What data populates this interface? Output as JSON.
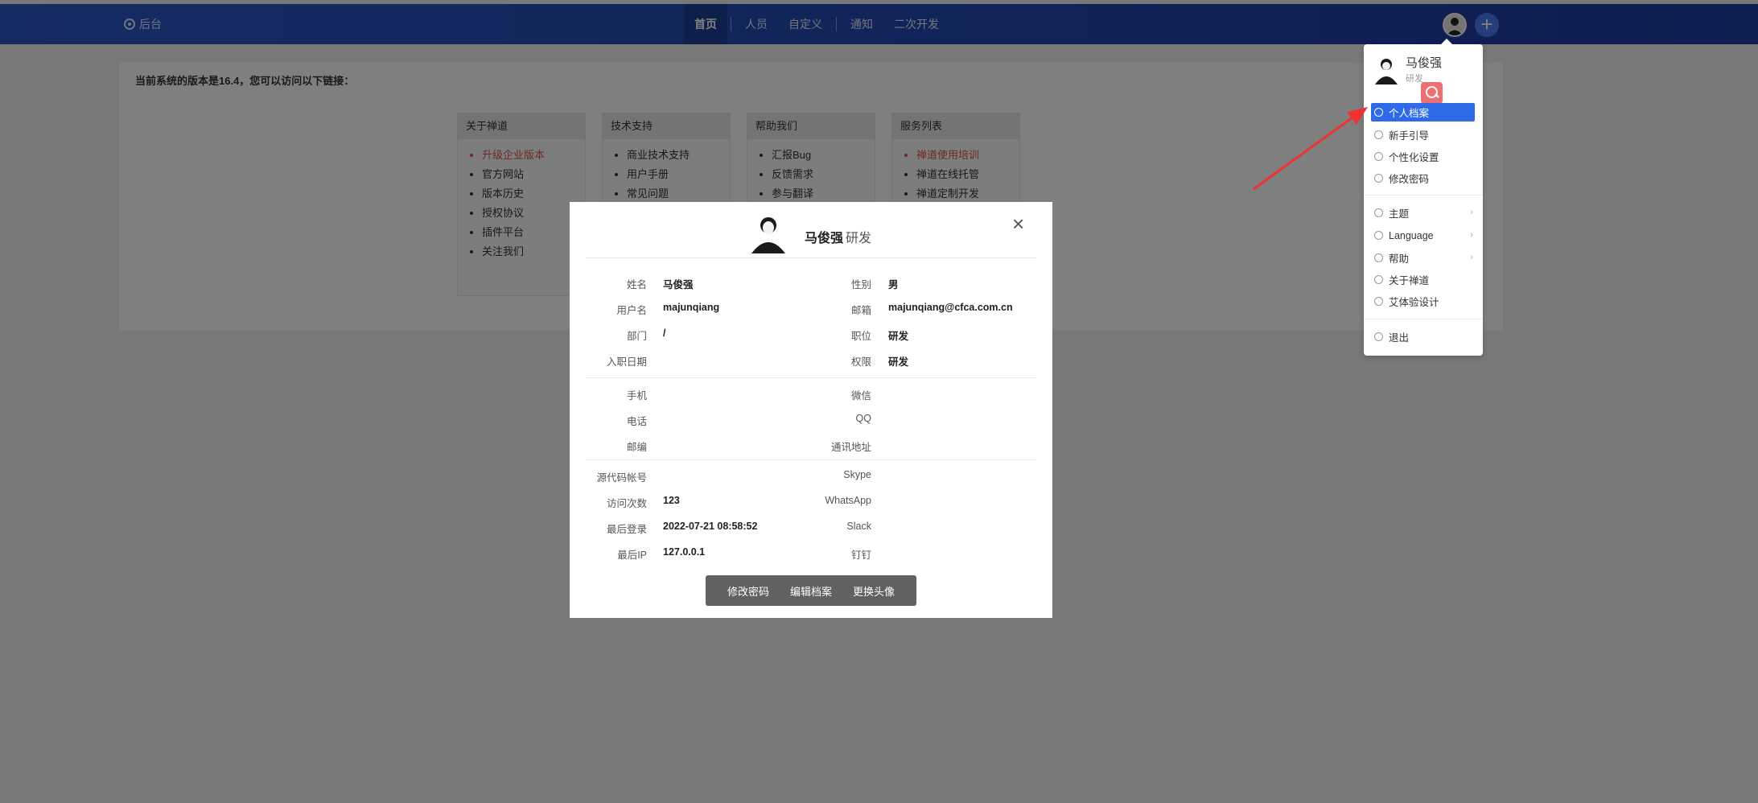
{
  "topbar": {
    "admin_label": "后台",
    "nav": [
      "首页",
      "人员",
      "自定义",
      "通知",
      "二次开发"
    ]
  },
  "panel": {
    "version_text": "当前系统的版本是16.4，您可以访问以下链接：",
    "boxes": [
      {
        "title": "关于禅道",
        "items": [
          "升级企业版本",
          "官方网站",
          "版本历史",
          "授权协议",
          "插件平台",
          "关注我们"
        ]
      },
      {
        "title": "技术支持",
        "items": [
          "商业技术支持",
          "用户手册",
          "常见问题"
        ]
      },
      {
        "title": "帮助我们",
        "items": [
          "汇报Bug",
          "反馈需求",
          "参与翻译"
        ]
      },
      {
        "title": "服务列表",
        "items": [
          "禅道使用培训",
          "禅道在线托管",
          "禅道定制开发"
        ]
      }
    ]
  },
  "dropdown": {
    "name": "马俊强",
    "role": "研发",
    "items": [
      "个人档案",
      "新手引导",
      "个性化设置",
      "修改密码",
      "主题",
      "Language",
      "帮助",
      "关于禅道",
      "艾体验设计",
      "退出"
    ]
  },
  "modal": {
    "name": "马俊强",
    "role": "研发",
    "close": "×",
    "rows": [
      {
        "l1": "姓名",
        "v1": "马俊强",
        "l2": "性别",
        "v2": "男"
      },
      {
        "l1": "用户名",
        "v1": "majunqiang",
        "l2": "邮箱",
        "v2": "majunqiang@cfca.com.cn"
      },
      {
        "l1": "部门",
        "v1": "/",
        "l2": "职位",
        "v2": "研发"
      },
      {
        "l1": "入职日期",
        "v1": "",
        "l2": "权限",
        "v2": "研发"
      },
      {
        "l1": "手机",
        "v1": "",
        "l2": "微信",
        "v2": ""
      },
      {
        "l1": "电话",
        "v1": "",
        "l2": "QQ",
        "v2": ""
      },
      {
        "l1": "邮编",
        "v1": "",
        "l2": "通讯地址",
        "v2": ""
      },
      {
        "l1": "源代码帐号",
        "v1": "",
        "l2": "Skype",
        "v2": ""
      },
      {
        "l1": "访问次数",
        "v1": "123",
        "l2": "WhatsApp",
        "v2": ""
      },
      {
        "l1": "最后登录",
        "v1": "2022-07-21 08:58:52",
        "l2": "Slack",
        "v2": ""
      },
      {
        "l1": "最后IP",
        "v1": "127.0.0.1",
        "l2": "钉钉",
        "v2": ""
      }
    ],
    "buttons": [
      "修改密码",
      "编辑档案",
      "更换头像"
    ]
  },
  "colors": {
    "header": "#2a58c6",
    "accent": "#2f6be9",
    "danger": "#e05050",
    "arrow": "#ee3333"
  }
}
